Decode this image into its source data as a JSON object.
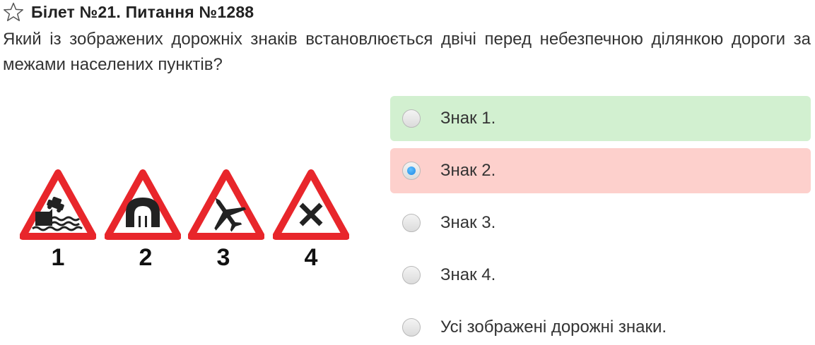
{
  "header": {
    "title": "Білет №21. Питання №1288",
    "favorite_icon": "star-outline-icon"
  },
  "question": {
    "text": "Який із зображених дорожніх знаків встановлюється двічі перед небезпечною ділянкою дороги за межами населених пунктів?"
  },
  "signs": [
    {
      "number": "1",
      "icon": "riverbank-sign-icon"
    },
    {
      "number": "2",
      "icon": "tunnel-sign-icon"
    },
    {
      "number": "3",
      "icon": "low-flying-aircraft-sign-icon"
    },
    {
      "number": "4",
      "icon": "other-danger-cross-sign-icon"
    }
  ],
  "answers": [
    {
      "label": "Знак 1.",
      "state": "correct",
      "selected": false
    },
    {
      "label": "Знак 2.",
      "state": "wrong",
      "selected": true
    },
    {
      "label": "Знак 3.",
      "state": "none",
      "selected": false
    },
    {
      "label": "Знак 4.",
      "state": "none",
      "selected": false
    },
    {
      "label": "Усі зображені дорожні знаки.",
      "state": "none",
      "selected": false
    }
  ],
  "colors": {
    "correct_bg": "#d2f0d0",
    "wrong_bg": "#fdd0cc",
    "sign_red": "#e8262b",
    "radio_selected": "#1e88e5"
  }
}
